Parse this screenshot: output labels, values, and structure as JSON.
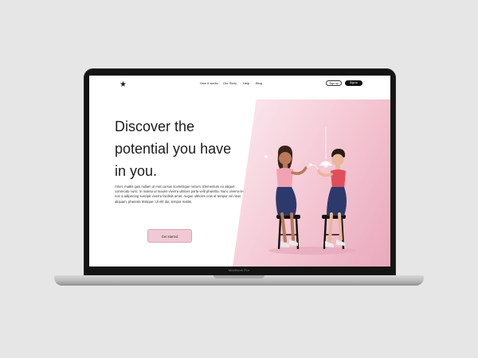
{
  "nav": {
    "links": [
      "How it works",
      "Our Story",
      "Help",
      "Blog"
    ],
    "signup": "Sign up",
    "signin": "Sign in"
  },
  "hero": {
    "title_line1": "Discover the",
    "title_line2": "potential you have",
    "title_line3": "in you.",
    "body": "Amet, mattis quis nullam ut erat cursus scelerisque rutrum. Elementum eu aliquet commodo nunc. In massa ut mauris viverra ultrices porta velit pharetra. Nunc viverra lectus non a adipiscing suscipit viverra facilisis amet. Augue ultricies cras at tempor vel risus aliquam, pharetra tristique. Ut elit dui, tempor mattis.",
    "cta": "Get started"
  },
  "device": {
    "label": "MacBook Pro"
  },
  "colors": {
    "accent": "#f1c9d4",
    "accent_dark": "#e9a9bd",
    "dark": "#111111"
  },
  "icons": {
    "logo": "star-icon"
  }
}
